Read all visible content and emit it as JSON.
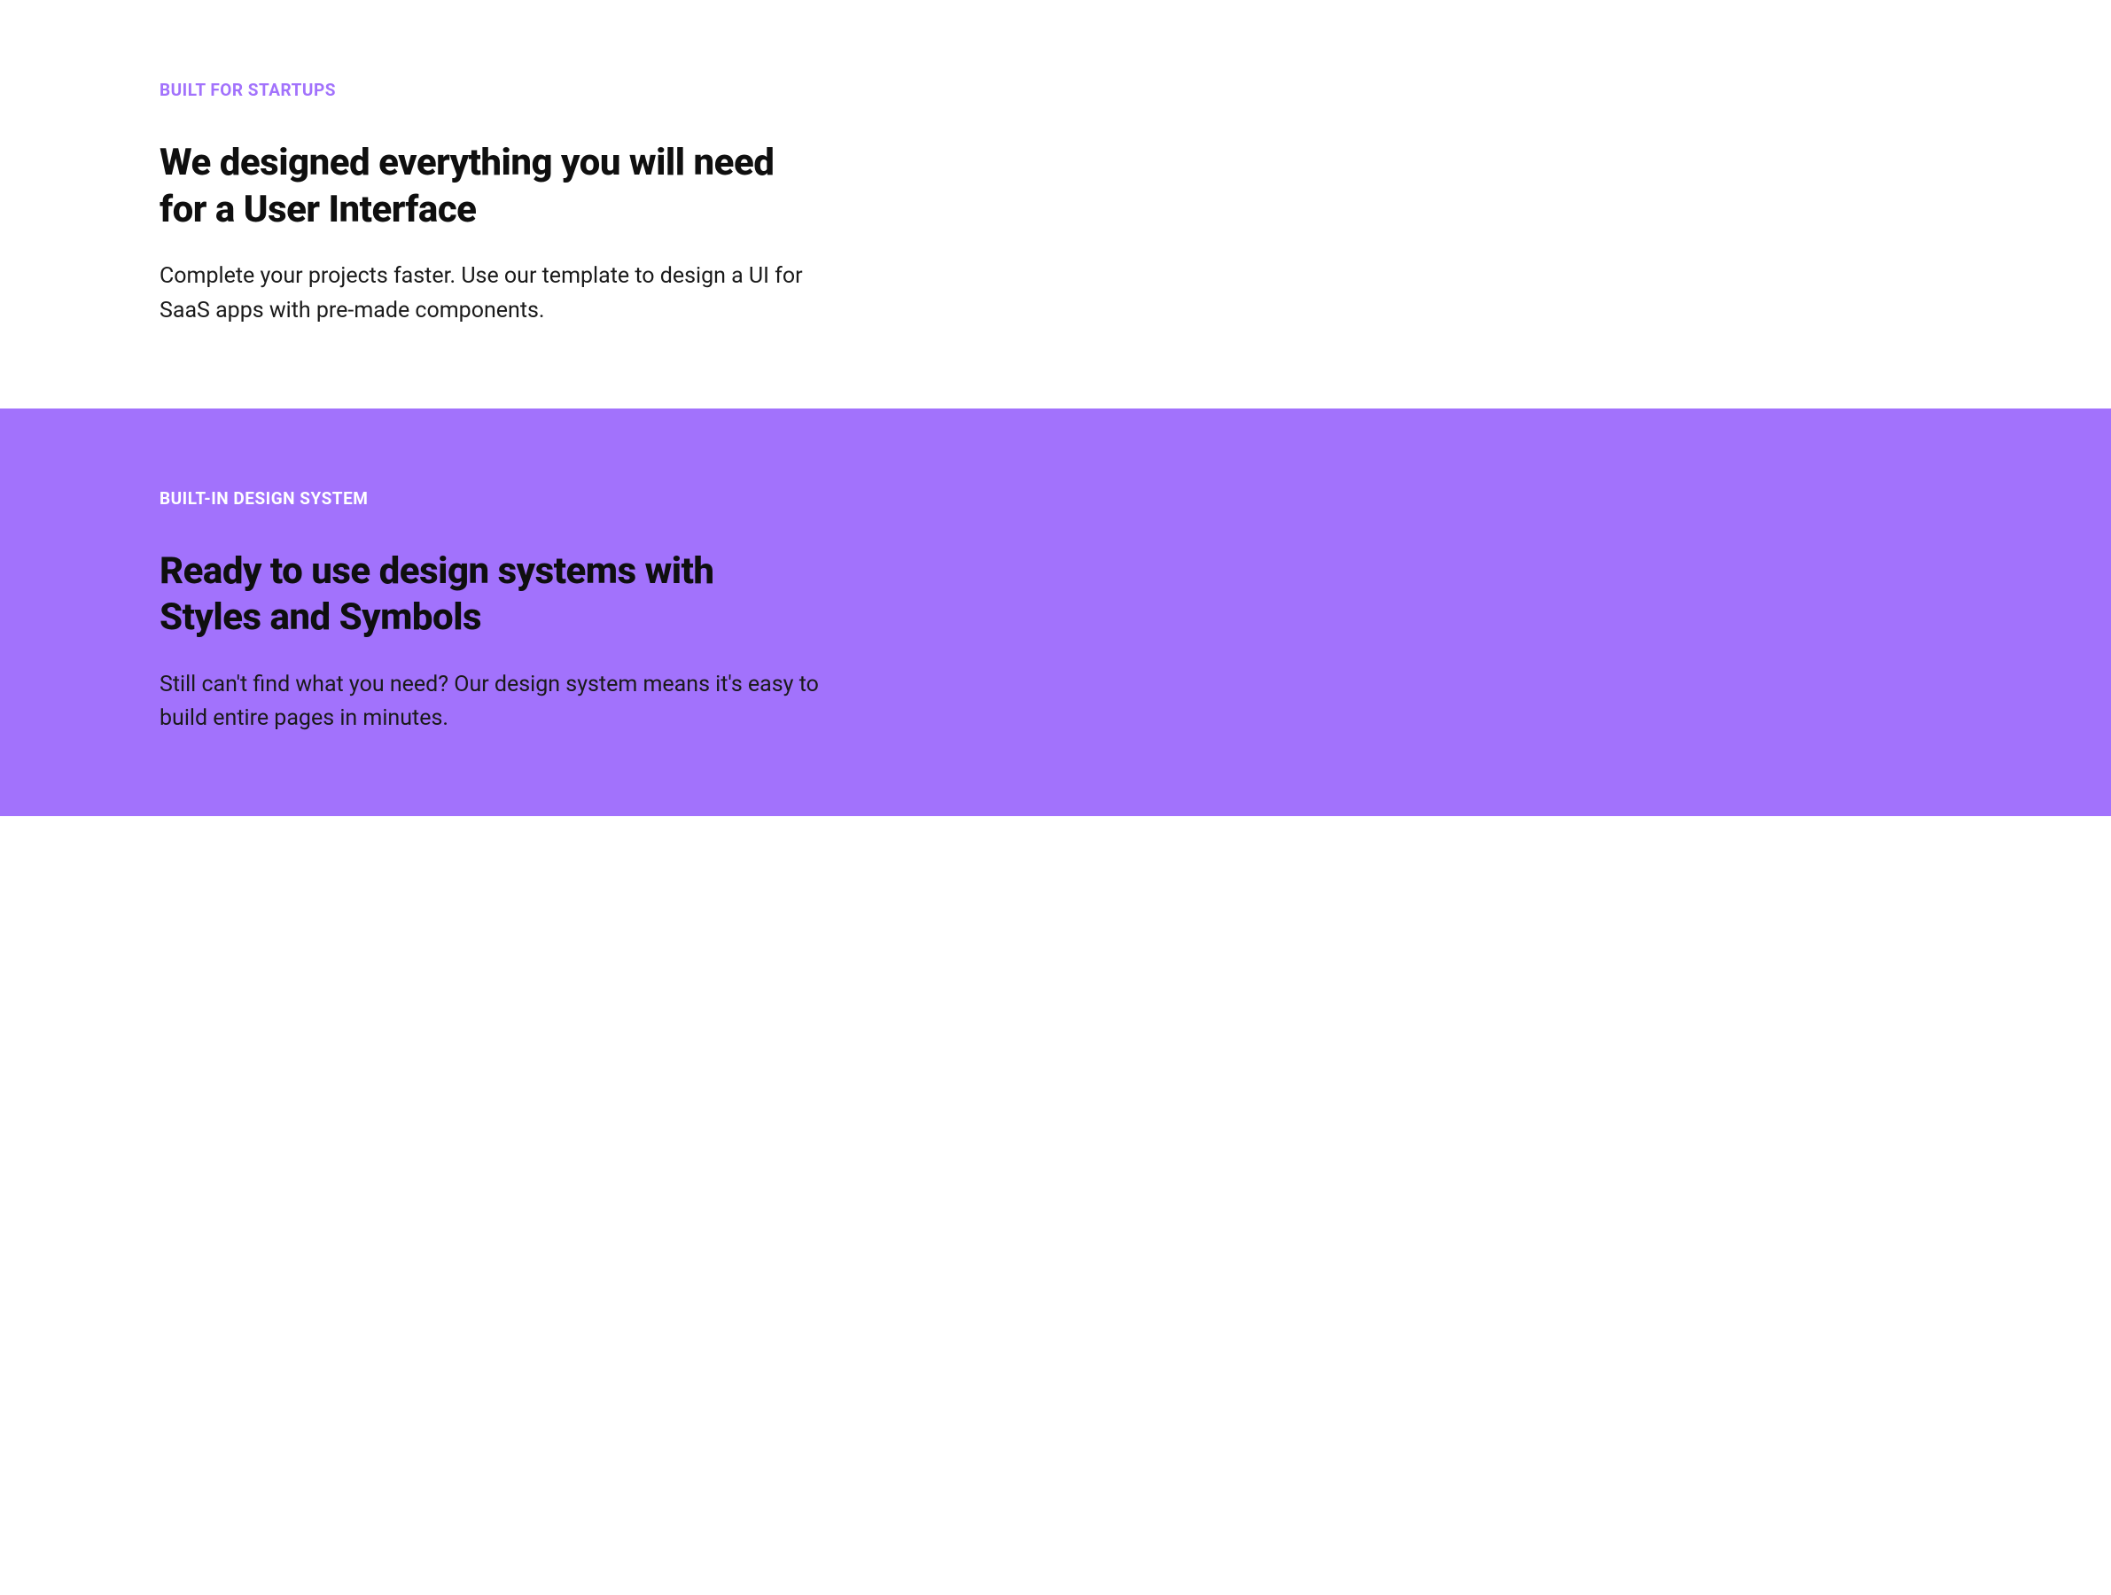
{
  "sections": [
    {
      "eyebrow": "BUILT FOR STARTUPS",
      "heading": "We designed everything you will need for a User Interface",
      "body": "Complete your projects faster. Use our template to design a UI for SaaS apps with pre-made components."
    },
    {
      "eyebrow": "BUILT-IN DESIGN SYSTEM",
      "heading": "Ready to use design systems with Styles and Symbols",
      "body": "Still can't find what you need? Our design system means it's easy to build entire pages in minutes."
    }
  ]
}
